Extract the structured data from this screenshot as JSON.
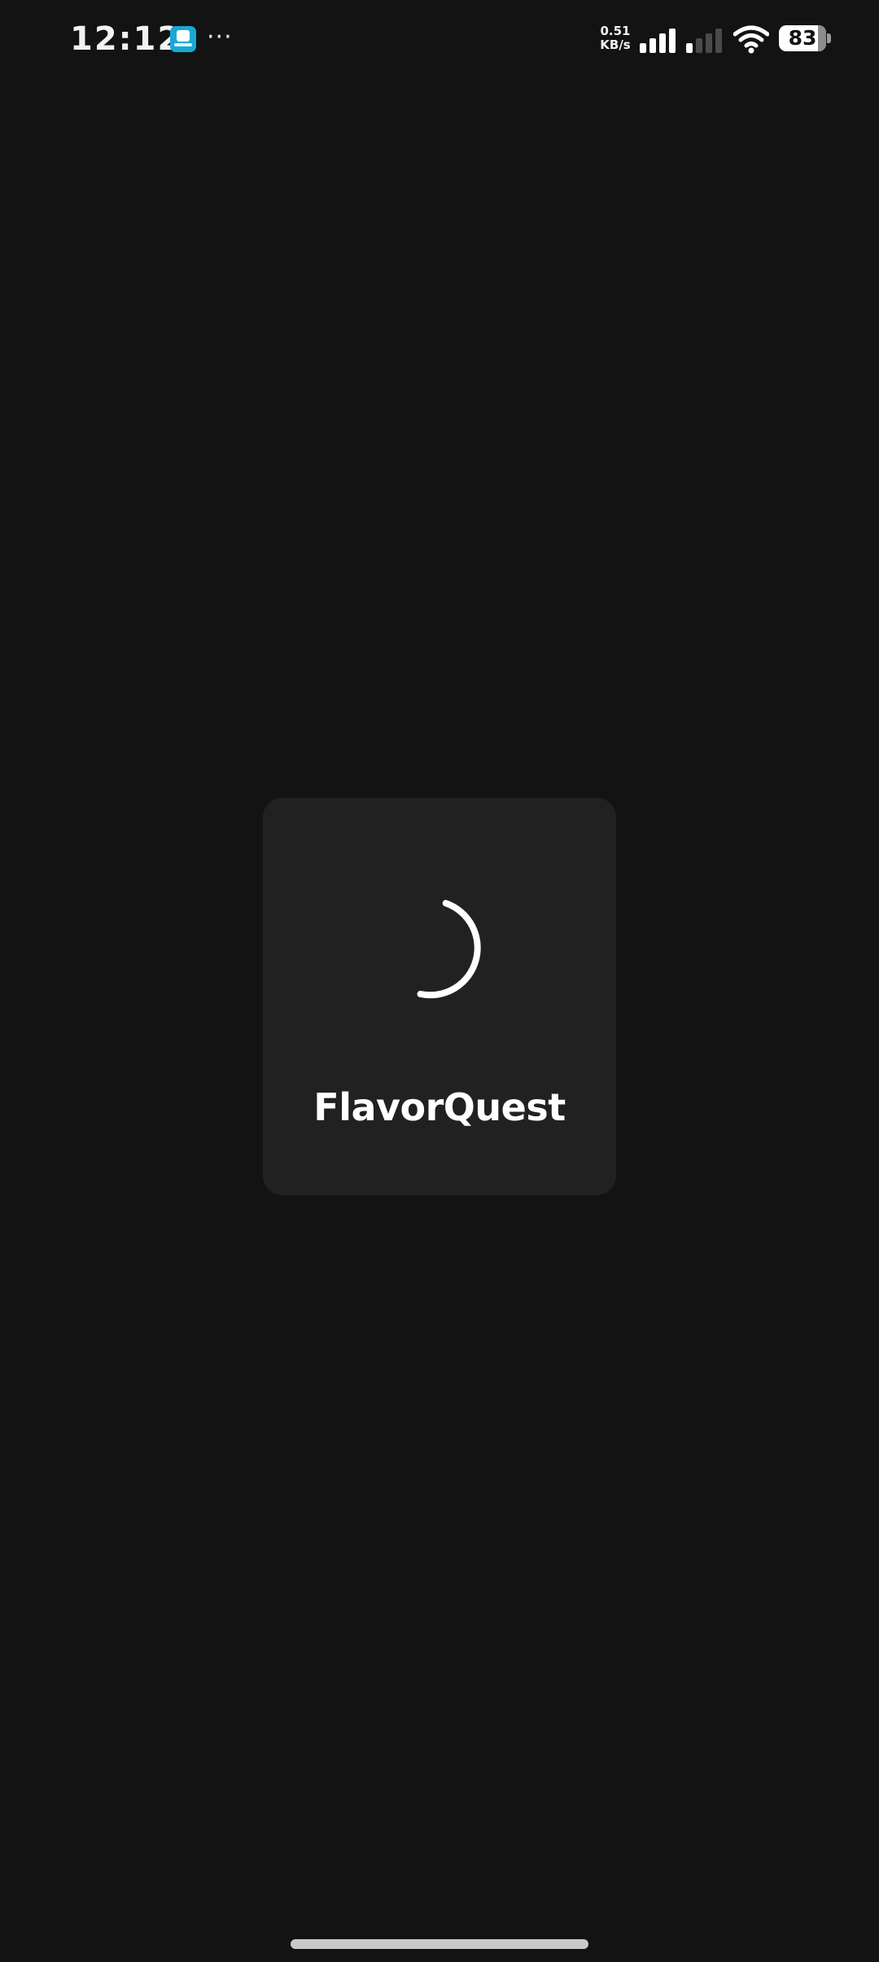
{
  "status_bar": {
    "time": "12:12",
    "notification_icon": "app-notification-icon",
    "overflow_indicator": "···",
    "net_speed_value": "0.51",
    "net_speed_unit": "KB/s",
    "signal_1_icon": "cellular-signal-icon",
    "signal_1_level": 4,
    "signal_2_icon": "cellular-signal-icon",
    "signal_2_level": 1,
    "wifi_icon": "wifi-icon",
    "battery_icon": "battery-icon",
    "battery_percent": "83",
    "battery_level": 0.83
  },
  "splash": {
    "app_name": "FlavorQuest",
    "spinner_icon": "loading-spinner-icon"
  },
  "colors": {
    "background": "#131313",
    "card": "#212121",
    "text": "#ffffff",
    "notification_icon": "#1aa7d4"
  },
  "navigation": {
    "home_indicator": "gesture-bar"
  }
}
